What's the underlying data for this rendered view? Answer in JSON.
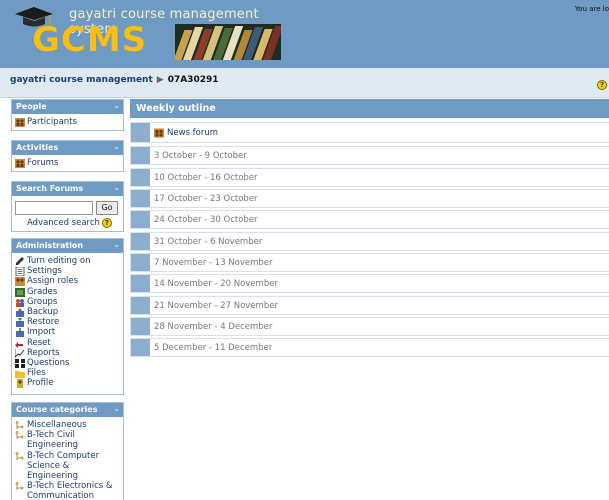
{
  "header": {
    "site_title": "gayatri course management system",
    "logo_text": "GCMS",
    "login_info": "You are lo"
  },
  "breadcrumb": {
    "home": "gayatri course management",
    "separator": "▶",
    "current": "07A30291"
  },
  "sidebar": {
    "people": {
      "title": "People",
      "items": [
        {
          "label": "Participants",
          "icon": "participants-icon"
        }
      ]
    },
    "activities": {
      "title": "Activities",
      "items": [
        {
          "label": "Forums",
          "icon": "forum-icon"
        }
      ]
    },
    "search": {
      "title": "Search Forums",
      "button": "Go",
      "advanced": "Advanced search",
      "help": "?"
    },
    "administration": {
      "title": "Administration",
      "items": [
        {
          "label": "Turn editing on",
          "icon": "edit-icon"
        },
        {
          "label": "Settings",
          "icon": "settings-icon"
        },
        {
          "label": "Assign roles",
          "icon": "roles-icon"
        },
        {
          "label": "Grades",
          "icon": "grades-icon"
        },
        {
          "label": "Groups",
          "icon": "groups-icon"
        },
        {
          "label": "Backup",
          "icon": "backup-icon"
        },
        {
          "label": "Restore",
          "icon": "restore-icon"
        },
        {
          "label": "Import",
          "icon": "import-icon"
        },
        {
          "label": "Reset",
          "icon": "reset-icon"
        },
        {
          "label": "Reports",
          "icon": "reports-icon"
        },
        {
          "label": "Questions",
          "icon": "questions-icon"
        },
        {
          "label": "Files",
          "icon": "folder-icon"
        },
        {
          "label": "Profile",
          "icon": "profile-icon"
        }
      ]
    },
    "categories": {
      "title": "Course categories",
      "items": [
        {
          "label": "Miscellaneous"
        },
        {
          "label": "B-Tech Civil Engineering"
        },
        {
          "label": "B-Tech Computer Science & Engineering"
        },
        {
          "label": "B-Tech Electronics & Communication Engineering"
        }
      ]
    },
    "toggle": "⌄"
  },
  "outline": {
    "title": "Weekly outline",
    "news_forum": "News forum",
    "weeks": [
      "3 October - 9 October",
      "10 October - 16 October",
      "17 October - 23 October",
      "24 October - 30 October",
      "31 October - 6 November",
      "7 November - 13 November",
      "14 November - 20 November",
      "21 November - 27 November",
      "28 November - 4 December",
      "5 December - 11 December"
    ]
  },
  "colors": {
    "header_bg": "#6f9ac4",
    "link": "#1d3d73",
    "week_side": "#8eaccd"
  }
}
